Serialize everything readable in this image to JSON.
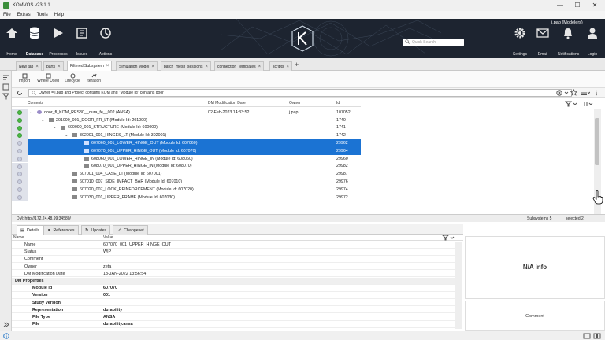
{
  "window": {
    "title": "KOMVOS v23.1.1",
    "minimize": "—",
    "maximize": "☐",
    "close": "✕"
  },
  "menu": [
    "File",
    "Extras",
    "Tools",
    "Help"
  ],
  "toolbar": {
    "items": [
      {
        "label": "Home",
        "icon": "home-icon"
      },
      {
        "label": "Database",
        "icon": "database-icon"
      },
      {
        "label": "Processes",
        "icon": "processes-icon"
      },
      {
        "label": "Issues",
        "icon": "issues-icon"
      },
      {
        "label": "Actions",
        "icon": "actions-icon"
      }
    ],
    "right_items": [
      {
        "label": "Settings",
        "icon": "gear-icon"
      },
      {
        "label": "Email",
        "icon": "email-icon"
      },
      {
        "label": "Notifications",
        "icon": "bell-icon"
      },
      {
        "label": "Login",
        "icon": "user-icon"
      }
    ],
    "user": "j.pap (Modelers)",
    "quick_search_placeholder": "Quick Search"
  },
  "tabs": [
    {
      "label": "New tab",
      "active": false
    },
    {
      "label": "parts",
      "active": false
    },
    {
      "label": "Filtered Subsystem",
      "active": true
    },
    {
      "label": "Simulation Model",
      "active": false
    },
    {
      "label": "batch_mesh_sessions",
      "active": false
    },
    {
      "label": "connection_templates",
      "active": false
    },
    {
      "label": "scripts",
      "active": false
    }
  ],
  "subtoolbar": [
    "Import",
    "Where Used",
    "Lifecycle",
    "Iteration"
  ],
  "filter": {
    "text": "Owner = j.pap and Project contains KOM and \"Module Id\" contains door"
  },
  "tree": {
    "columns": [
      "Contents",
      "DM Modification Date",
      "Owner",
      "Id"
    ],
    "rows": [
      {
        "indent": 0,
        "name": "door_fl_KOM_RES30__dura_fe__002 (ANSA)",
        "date": "02-Feb-2023 14:33:52",
        "owner": "j.pap",
        "id": "107052",
        "status": "green",
        "selected": false
      },
      {
        "indent": 1,
        "name": "201000_001_DOOR_FR_LT (Module Id: 201000)",
        "date": "",
        "owner": "",
        "id": "1740",
        "status": "green",
        "selected": false
      },
      {
        "indent": 2,
        "name": "600000_001_STRUCTURE (Module Id: 600000)",
        "date": "",
        "owner": "",
        "id": "1741",
        "status": "green",
        "selected": false
      },
      {
        "indent": 3,
        "name": "302001_001_HINGES_LT (Module Id: 302001)",
        "date": "",
        "owner": "",
        "id": "1742",
        "status": "green",
        "selected": false
      },
      {
        "indent": 4,
        "name": "607060_001_LOWER_HINGE_OUT (Module Id: 607060)",
        "date": "",
        "owner": "",
        "id": "29962",
        "status": "plain",
        "selected": true
      },
      {
        "indent": 4,
        "name": "607070_001_UPPER_HINGE_OUT (Module Id: 607070)",
        "date": "",
        "owner": "",
        "id": "29964",
        "status": "plain",
        "selected": true
      },
      {
        "indent": 4,
        "name": "608060_001_LOWER_HINGE_IN (Module Id: 608060)",
        "date": "",
        "owner": "",
        "id": "29960",
        "status": "plain",
        "selected": false
      },
      {
        "indent": 4,
        "name": "608070_001_UPPER_HINGE_IN (Module Id: 608070)",
        "date": "",
        "owner": "",
        "id": "29982",
        "status": "plain",
        "selected": false
      },
      {
        "indent": 3,
        "name": "607001_004_CASE_LT (Module Id: 607001)",
        "date": "",
        "owner": "",
        "id": "29987",
        "status": "plain",
        "selected": false
      },
      {
        "indent": 3,
        "name": "607010_007_SIDE_IMPACT_BAR (Module Id: 607010)",
        "date": "",
        "owner": "",
        "id": "29976",
        "status": "plain",
        "selected": false
      },
      {
        "indent": 3,
        "name": "607020_007_LOCK_REINFORCEMENT (Module Id: 607020)",
        "date": "",
        "owner": "",
        "id": "29974",
        "status": "plain",
        "selected": false
      },
      {
        "indent": 3,
        "name": "607030_001_UPPER_FRAME (Module Id: 607030)",
        "date": "",
        "owner": "",
        "id": "29972",
        "status": "plain",
        "selected": false
      }
    ]
  },
  "status": {
    "dm": "DM: http://172.24.48.99:34580/",
    "subsystems": "Subsystems 5",
    "selected": "selected 2"
  },
  "bottom_tabs": [
    "Details",
    "References",
    "Updates",
    "Changeset"
  ],
  "properties": {
    "columns": [
      "Name",
      "Value"
    ],
    "rows": [
      {
        "type": "row",
        "name": "Name",
        "value": "607070_001_UPPER_HINGE_OUT"
      },
      {
        "type": "row",
        "name": "Status",
        "value": "WIP"
      },
      {
        "type": "row",
        "name": "Comment",
        "value": ""
      },
      {
        "type": "row",
        "name": "Owner",
        "value": "zeta"
      },
      {
        "type": "row",
        "name": "DM Modification Date",
        "value": "13-JAN-2022 13:56:54"
      },
      {
        "type": "group",
        "name": "DM Properties",
        "value": ""
      },
      {
        "type": "bold",
        "name": "Module Id",
        "value": "607070"
      },
      {
        "type": "bold",
        "name": "Version",
        "value": "001"
      },
      {
        "type": "bold",
        "name": "Study Version",
        "value": ""
      },
      {
        "type": "bold",
        "name": "Representation",
        "value": "durability"
      },
      {
        "type": "bold",
        "name": "File Type",
        "value": "ANSA"
      },
      {
        "type": "bold",
        "name": "File",
        "value": "durability.ansa"
      }
    ]
  },
  "right_panel": {
    "info": "N/A info",
    "comment": "Comment"
  }
}
